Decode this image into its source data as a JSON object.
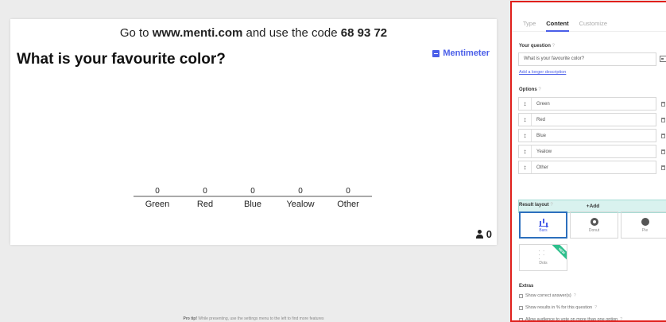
{
  "slide": {
    "instruction_prefix": "Go to ",
    "instruction_url": "www.menti.com",
    "instruction_mid": " and use the code ",
    "instruction_code": "68 93 72",
    "question": "What is your favourite color?",
    "brand": "Mentimeter",
    "vote_count": "0"
  },
  "chart_data": {
    "type": "bar",
    "categories": [
      "Green",
      "Red",
      "Blue",
      "Yealow",
      "Other"
    ],
    "values": [
      0,
      0,
      0,
      0,
      0
    ]
  },
  "protip": {
    "lead": "Pro tip!",
    "text": " While presenting, use the settings menu to the left to find more features"
  },
  "panel": {
    "tabs": [
      "Type",
      "Content",
      "Customize"
    ],
    "active_tab": "Content",
    "question_label": "Your question",
    "help_mark": "?",
    "question_value": "What is your favourite color?",
    "longer_description": "Add a longer description",
    "options_label": "Options",
    "options": [
      "Green",
      "Red",
      "Blue",
      "Yealow",
      "Other"
    ],
    "grip_glyph": "↕",
    "add_label": "+Add",
    "result_layout_label": "Result layout",
    "layouts": [
      "Bars",
      "Donut",
      "Pie",
      "Dots"
    ],
    "new_badge": "NEW",
    "extras_label": "Extras",
    "extras": [
      "Show correct answer(s)",
      "Show results in % for this question",
      "Allow audience to vote on more than one option"
    ]
  },
  "colors": {
    "accent": "#4a5ee8",
    "highlight_border": "#e0201c",
    "add_bg": "#d9f2ef",
    "new_badge": "#2dbf8c"
  }
}
